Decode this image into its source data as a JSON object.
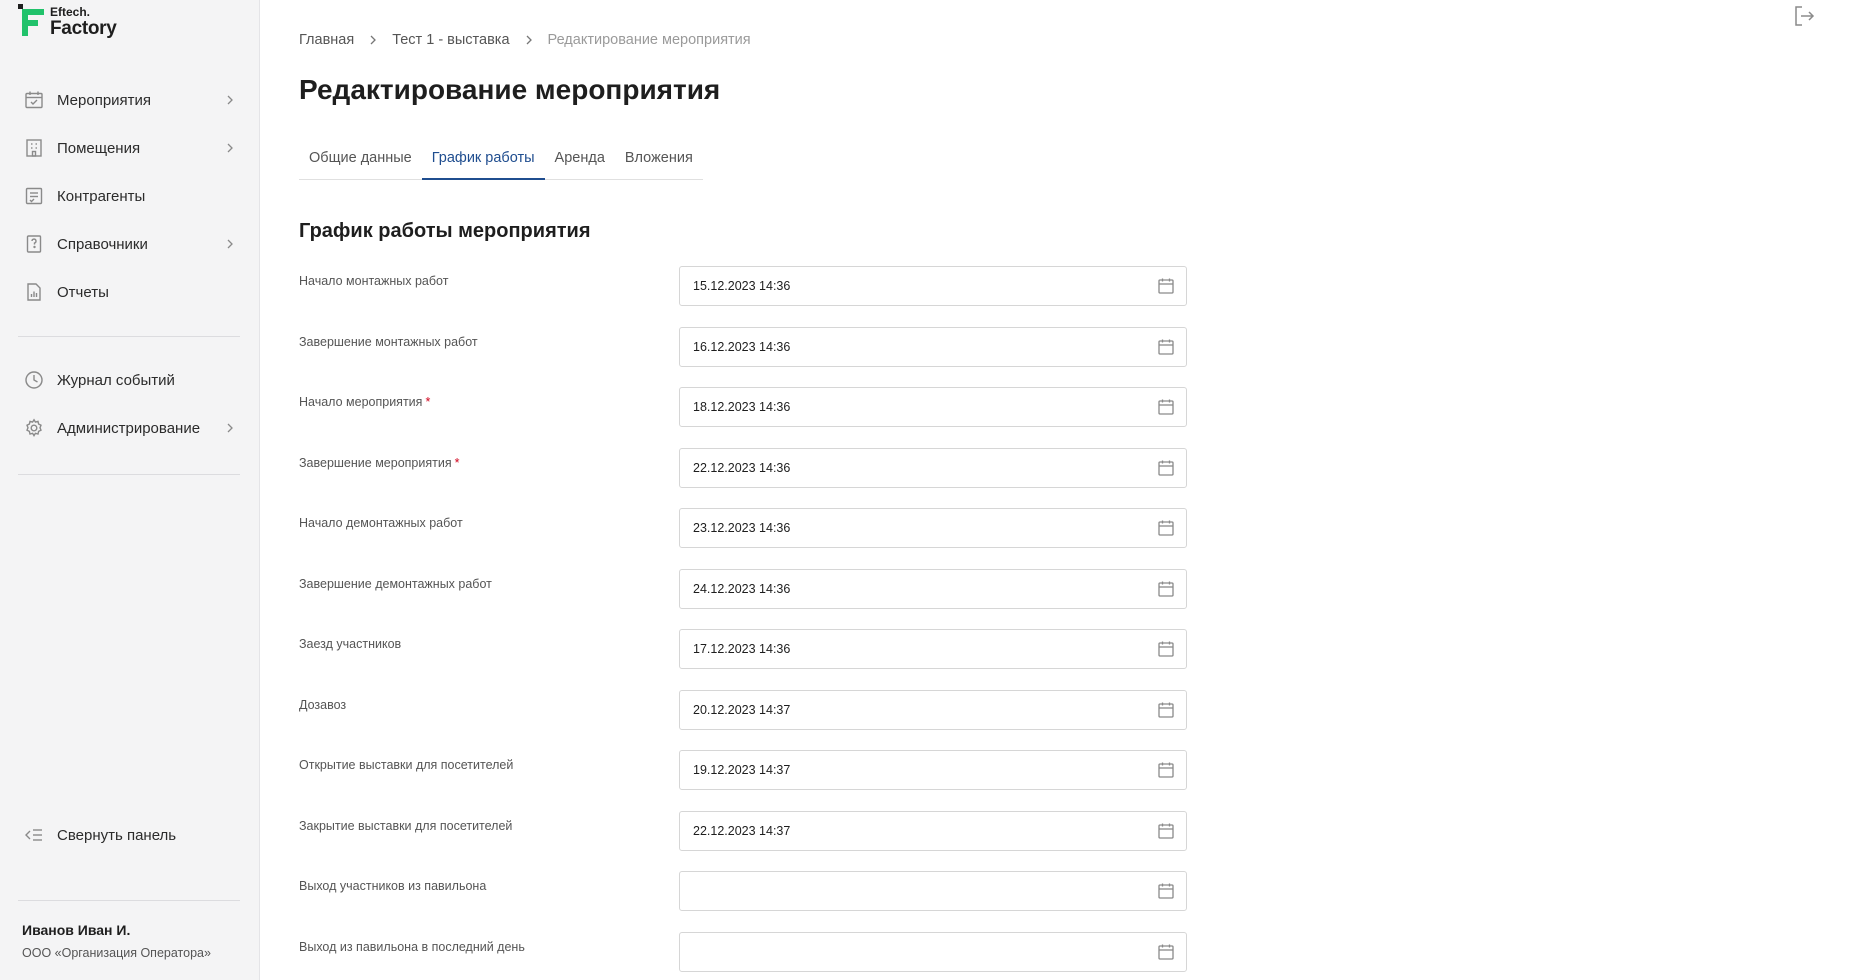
{
  "brand": {
    "line1": "Eftech.",
    "line2": "Factory",
    "accent": "#21c26b"
  },
  "sidebar": {
    "items": [
      {
        "label": "Мероприятия",
        "icon": "calendar-check-icon",
        "has_submenu": true
      },
      {
        "label": "Помещения",
        "icon": "building-icon",
        "has_submenu": true
      },
      {
        "label": "Контрагенты",
        "icon": "contacts-icon",
        "has_submenu": false
      },
      {
        "label": "Справочники",
        "icon": "reference-book-icon",
        "has_submenu": true
      },
      {
        "label": "Отчеты",
        "icon": "report-icon",
        "has_submenu": false
      }
    ],
    "secondary": [
      {
        "label": "Журнал событий",
        "icon": "clock-icon",
        "has_submenu": false
      },
      {
        "label": "Администрирование",
        "icon": "gear-icon",
        "has_submenu": true
      }
    ],
    "collapse_label": "Свернуть панель",
    "user": {
      "name": "Иванов Иван И.",
      "org": "ООО «Организация Оператора»"
    }
  },
  "breadcrumb": [
    "Главная",
    "Тест 1 - выставка",
    "Редактирование мероприятия"
  ],
  "page_title": "Редактирование мероприятия",
  "tabs": [
    {
      "label": "Общие данные",
      "active": false
    },
    {
      "label": "График работы",
      "active": true
    },
    {
      "label": "Аренда",
      "active": false
    },
    {
      "label": "Вложения",
      "active": false
    }
  ],
  "section_title": "График работы мероприятия",
  "fields": [
    {
      "label": "Начало монтажных работ",
      "required": false,
      "value": "15.12.2023 14:36"
    },
    {
      "label": "Завершение монтажных работ",
      "required": false,
      "value": "16.12.2023 14:36"
    },
    {
      "label": "Начало мероприятия",
      "required": true,
      "value": "18.12.2023 14:36"
    },
    {
      "label": "Завершение мероприятия",
      "required": true,
      "value": "22.12.2023 14:36"
    },
    {
      "label": "Начало демонтажных работ",
      "required": false,
      "value": "23.12.2023 14:36"
    },
    {
      "label": "Завершение демонтажных работ",
      "required": false,
      "value": "24.12.2023 14:36"
    },
    {
      "label": "Заезд участников",
      "required": false,
      "value": "17.12.2023 14:36"
    },
    {
      "label": "Дозавоз",
      "required": false,
      "value": "20.12.2023 14:37"
    },
    {
      "label": "Открытие выставки для посетителей",
      "required": false,
      "value": "19.12.2023 14:37"
    },
    {
      "label": "Закрытие выставки для посетителей",
      "required": false,
      "value": "22.12.2023 14:37"
    },
    {
      "label": "Выход участников из павильона",
      "required": false,
      "value": ""
    },
    {
      "label": "Выход из павильона в последний день",
      "required": false,
      "value": ""
    }
  ],
  "required_marker": "*",
  "colors": {
    "active_tab": "#1f4d8f",
    "required": "#d0021b",
    "sidebar_bg": "#f4f4f5"
  }
}
